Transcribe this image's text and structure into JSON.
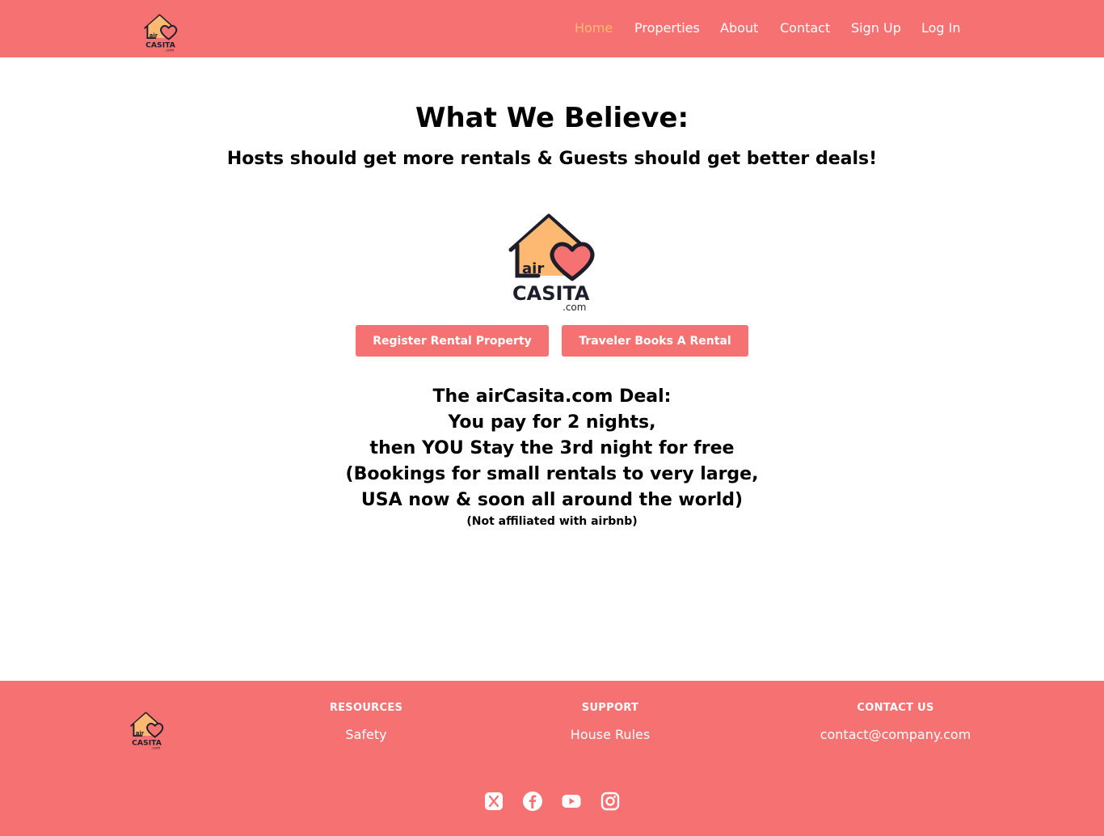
{
  "header": {
    "logo_text": "airCASITA.com",
    "nav": [
      {
        "label": "Home",
        "active": true
      },
      {
        "label": "Properties",
        "active": false
      },
      {
        "label": "About",
        "active": false
      },
      {
        "label": "Contact",
        "active": false
      },
      {
        "label": "Sign Up",
        "active": false
      },
      {
        "label": "Log In",
        "active": false
      }
    ]
  },
  "hero": {
    "title": "What We Believe:",
    "subtitle": "Hosts should get more rentals & Guests should get better deals!",
    "logo_text": "airCASITA.com",
    "buttons": {
      "register": "Register Rental Property",
      "book": "Traveler Books A Rental"
    },
    "deal_lines": [
      "The airCasita.com Deal:",
      "You pay for 2 nights,",
      "then YOU Stay the 3rd night for free",
      "(Bookings for small rentals to very large,",
      "USA now & soon all around the world)"
    ],
    "disclaimer": "(Not affiliated with airbnb)"
  },
  "footer": {
    "logo_text": "airCASITA.com",
    "resources": {
      "heading": "RESOURCES",
      "links": [
        "Safety"
      ]
    },
    "support": {
      "heading": "SUPPORT",
      "links": [
        "House Rules"
      ]
    },
    "contact": {
      "heading": "CONTACT US",
      "email": "contact@company.com"
    },
    "social": [
      "x-icon",
      "facebook-icon",
      "youtube-icon",
      "instagram-icon"
    ]
  },
  "colors": {
    "brand": "#f67272",
    "accent": "#fdb872",
    "house_outline": "#1e1e2a",
    "heart": "#f67272"
  }
}
